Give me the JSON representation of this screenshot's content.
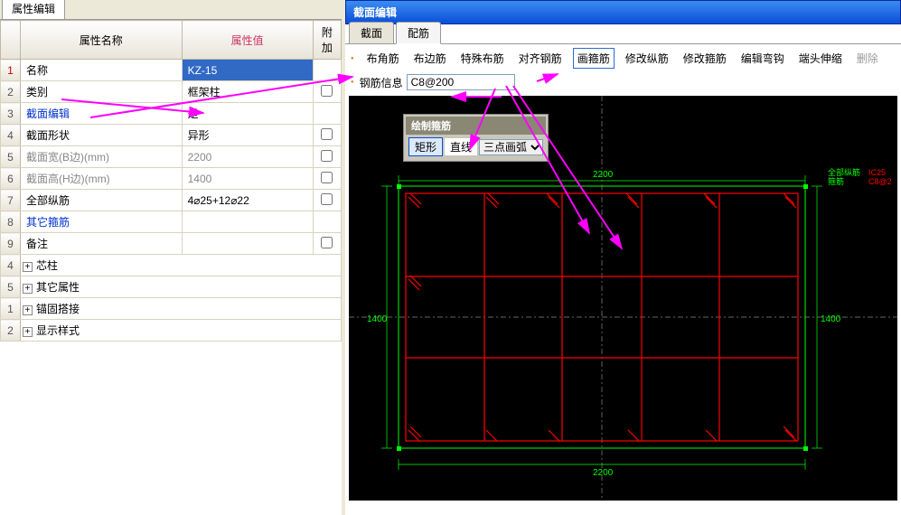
{
  "leftTab": "属性编辑",
  "headers": {
    "name": "属性名称",
    "value": "属性值",
    "extra": "附加"
  },
  "rows": [
    {
      "idx": "1",
      "name": "名称",
      "value": "KZ-15",
      "link": false,
      "chk": null,
      "sel": true
    },
    {
      "idx": "2",
      "name": "类别",
      "value": "框架柱",
      "link": false,
      "chk": false
    },
    {
      "idx": "3",
      "name": "截面编辑",
      "value": "是",
      "link": true,
      "chk": null
    },
    {
      "idx": "4",
      "name": "截面形状",
      "value": "异形",
      "link": false,
      "chk": false
    },
    {
      "idx": "5",
      "name": "截面宽(B边)(mm)",
      "value": "2200",
      "link": false,
      "chk": false,
      "gray": true
    },
    {
      "idx": "6",
      "name": "截面高(H边)(mm)",
      "value": "1400",
      "link": false,
      "chk": false,
      "gray": true
    },
    {
      "idx": "7",
      "name": "全部纵筋",
      "value": "4⌀25+12⌀22",
      "link": false,
      "chk": false
    },
    {
      "idx": "8",
      "name": "其它箍筋",
      "value": "",
      "link": true,
      "chk": null
    },
    {
      "idx": "9",
      "name": "备注",
      "value": "",
      "link": false,
      "chk": false
    }
  ],
  "groups": [
    {
      "idx": "4",
      "name": "芯柱"
    },
    {
      "idx": "5",
      "name": "其它属性"
    },
    {
      "idx": "1",
      "name": "锚固搭接"
    },
    {
      "idx": "2",
      "name": "显示样式"
    }
  ],
  "sectionEditor": {
    "title": "截面编辑",
    "tabs": {
      "a": "截面",
      "b": "配筋"
    },
    "toolbar": {
      "corner": "布角筋",
      "edge": "布边筋",
      "special": "特殊布筋",
      "align": "对齐钢筋",
      "draw": "画箍筋",
      "modVert": "修改纵筋",
      "modStir": "修改箍筋",
      "editHook": "编辑弯钩",
      "endExt": "端头伸缩",
      "del": "删除"
    },
    "steelLabel": "钢筋信息",
    "steelValue": "C8@200",
    "drawPanel": {
      "title": "绘制箍筋",
      "rect": "矩形",
      "line": "直线",
      "arc": "三点画弧"
    },
    "dims": {
      "w": "2200",
      "h": "1400"
    },
    "legend": {
      "a": "全部纵筋",
      "b": "箍筋",
      "c": "IC25",
      "d": "C8@2"
    }
  }
}
